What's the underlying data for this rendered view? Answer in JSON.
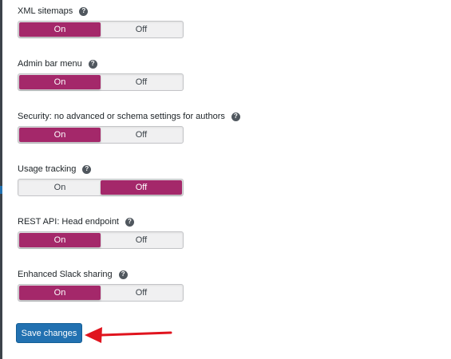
{
  "settings": [
    {
      "label": "XML sitemaps",
      "help_glyph": "?",
      "on_label": "On",
      "off_label": "Off",
      "selected": "on"
    },
    {
      "label": "Admin bar menu",
      "help_glyph": "?",
      "on_label": "On",
      "off_label": "Off",
      "selected": "on"
    },
    {
      "label": "Security: no advanced or schema settings for authors",
      "help_glyph": "?",
      "on_label": "On",
      "off_label": "Off",
      "selected": "on"
    },
    {
      "label": "Usage tracking",
      "help_glyph": "?",
      "on_label": "On",
      "off_label": "Off",
      "selected": "off"
    },
    {
      "label": "REST API: Head endpoint",
      "help_glyph": "?",
      "on_label": "On",
      "off_label": "Off",
      "selected": "on"
    },
    {
      "label": "Enhanced Slack sharing",
      "help_glyph": "?",
      "on_label": "On",
      "off_label": "Off",
      "selected": "on"
    }
  ],
  "save_button": {
    "label": "Save changes"
  },
  "annotation": {
    "icon": "red-arrow-icon",
    "color": "#e0141e"
  },
  "colors": {
    "toggle_active": "#a4286a",
    "button": "#2271b1"
  }
}
